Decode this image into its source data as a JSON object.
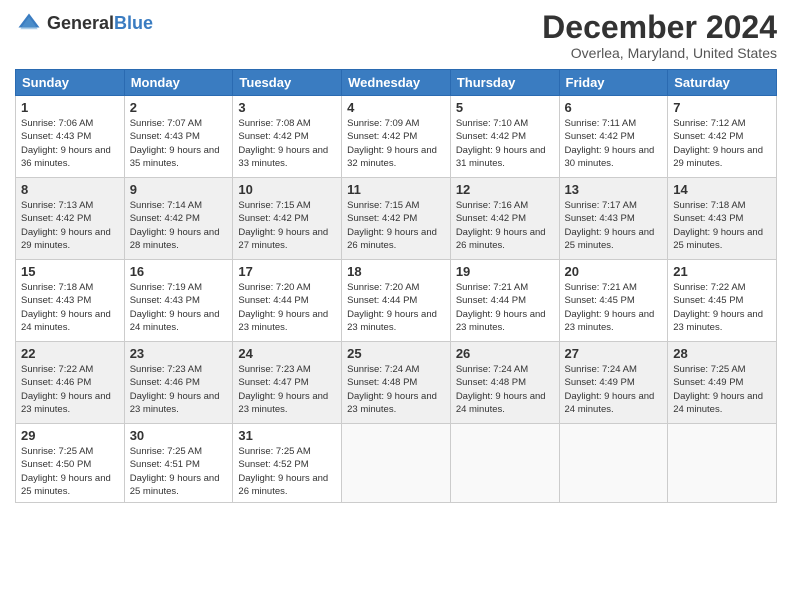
{
  "header": {
    "logo_general": "General",
    "logo_blue": "Blue",
    "title": "December 2024",
    "location": "Overlea, Maryland, United States"
  },
  "columns": [
    "Sunday",
    "Monday",
    "Tuesday",
    "Wednesday",
    "Thursday",
    "Friday",
    "Saturday"
  ],
  "weeks": [
    [
      {
        "day": "1",
        "sunrise": "Sunrise: 7:06 AM",
        "sunset": "Sunset: 4:43 PM",
        "daylight": "Daylight: 9 hours and 36 minutes."
      },
      {
        "day": "2",
        "sunrise": "Sunrise: 7:07 AM",
        "sunset": "Sunset: 4:43 PM",
        "daylight": "Daylight: 9 hours and 35 minutes."
      },
      {
        "day": "3",
        "sunrise": "Sunrise: 7:08 AM",
        "sunset": "Sunset: 4:42 PM",
        "daylight": "Daylight: 9 hours and 33 minutes."
      },
      {
        "day": "4",
        "sunrise": "Sunrise: 7:09 AM",
        "sunset": "Sunset: 4:42 PM",
        "daylight": "Daylight: 9 hours and 32 minutes."
      },
      {
        "day": "5",
        "sunrise": "Sunrise: 7:10 AM",
        "sunset": "Sunset: 4:42 PM",
        "daylight": "Daylight: 9 hours and 31 minutes."
      },
      {
        "day": "6",
        "sunrise": "Sunrise: 7:11 AM",
        "sunset": "Sunset: 4:42 PM",
        "daylight": "Daylight: 9 hours and 30 minutes."
      },
      {
        "day": "7",
        "sunrise": "Sunrise: 7:12 AM",
        "sunset": "Sunset: 4:42 PM",
        "daylight": "Daylight: 9 hours and 29 minutes."
      }
    ],
    [
      {
        "day": "8",
        "sunrise": "Sunrise: 7:13 AM",
        "sunset": "Sunset: 4:42 PM",
        "daylight": "Daylight: 9 hours and 29 minutes."
      },
      {
        "day": "9",
        "sunrise": "Sunrise: 7:14 AM",
        "sunset": "Sunset: 4:42 PM",
        "daylight": "Daylight: 9 hours and 28 minutes."
      },
      {
        "day": "10",
        "sunrise": "Sunrise: 7:15 AM",
        "sunset": "Sunset: 4:42 PM",
        "daylight": "Daylight: 9 hours and 27 minutes."
      },
      {
        "day": "11",
        "sunrise": "Sunrise: 7:15 AM",
        "sunset": "Sunset: 4:42 PM",
        "daylight": "Daylight: 9 hours and 26 minutes."
      },
      {
        "day": "12",
        "sunrise": "Sunrise: 7:16 AM",
        "sunset": "Sunset: 4:42 PM",
        "daylight": "Daylight: 9 hours and 26 minutes."
      },
      {
        "day": "13",
        "sunrise": "Sunrise: 7:17 AM",
        "sunset": "Sunset: 4:43 PM",
        "daylight": "Daylight: 9 hours and 25 minutes."
      },
      {
        "day": "14",
        "sunrise": "Sunrise: 7:18 AM",
        "sunset": "Sunset: 4:43 PM",
        "daylight": "Daylight: 9 hours and 25 minutes."
      }
    ],
    [
      {
        "day": "15",
        "sunrise": "Sunrise: 7:18 AM",
        "sunset": "Sunset: 4:43 PM",
        "daylight": "Daylight: 9 hours and 24 minutes."
      },
      {
        "day": "16",
        "sunrise": "Sunrise: 7:19 AM",
        "sunset": "Sunset: 4:43 PM",
        "daylight": "Daylight: 9 hours and 24 minutes."
      },
      {
        "day": "17",
        "sunrise": "Sunrise: 7:20 AM",
        "sunset": "Sunset: 4:44 PM",
        "daylight": "Daylight: 9 hours and 23 minutes."
      },
      {
        "day": "18",
        "sunrise": "Sunrise: 7:20 AM",
        "sunset": "Sunset: 4:44 PM",
        "daylight": "Daylight: 9 hours and 23 minutes."
      },
      {
        "day": "19",
        "sunrise": "Sunrise: 7:21 AM",
        "sunset": "Sunset: 4:44 PM",
        "daylight": "Daylight: 9 hours and 23 minutes."
      },
      {
        "day": "20",
        "sunrise": "Sunrise: 7:21 AM",
        "sunset": "Sunset: 4:45 PM",
        "daylight": "Daylight: 9 hours and 23 minutes."
      },
      {
        "day": "21",
        "sunrise": "Sunrise: 7:22 AM",
        "sunset": "Sunset: 4:45 PM",
        "daylight": "Daylight: 9 hours and 23 minutes."
      }
    ],
    [
      {
        "day": "22",
        "sunrise": "Sunrise: 7:22 AM",
        "sunset": "Sunset: 4:46 PM",
        "daylight": "Daylight: 9 hours and 23 minutes."
      },
      {
        "day": "23",
        "sunrise": "Sunrise: 7:23 AM",
        "sunset": "Sunset: 4:46 PM",
        "daylight": "Daylight: 9 hours and 23 minutes."
      },
      {
        "day": "24",
        "sunrise": "Sunrise: 7:23 AM",
        "sunset": "Sunset: 4:47 PM",
        "daylight": "Daylight: 9 hours and 23 minutes."
      },
      {
        "day": "25",
        "sunrise": "Sunrise: 7:24 AM",
        "sunset": "Sunset: 4:48 PM",
        "daylight": "Daylight: 9 hours and 23 minutes."
      },
      {
        "day": "26",
        "sunrise": "Sunrise: 7:24 AM",
        "sunset": "Sunset: 4:48 PM",
        "daylight": "Daylight: 9 hours and 24 minutes."
      },
      {
        "day": "27",
        "sunrise": "Sunrise: 7:24 AM",
        "sunset": "Sunset: 4:49 PM",
        "daylight": "Daylight: 9 hours and 24 minutes."
      },
      {
        "day": "28",
        "sunrise": "Sunrise: 7:25 AM",
        "sunset": "Sunset: 4:49 PM",
        "daylight": "Daylight: 9 hours and 24 minutes."
      }
    ],
    [
      {
        "day": "29",
        "sunrise": "Sunrise: 7:25 AM",
        "sunset": "Sunset: 4:50 PM",
        "daylight": "Daylight: 9 hours and 25 minutes."
      },
      {
        "day": "30",
        "sunrise": "Sunrise: 7:25 AM",
        "sunset": "Sunset: 4:51 PM",
        "daylight": "Daylight: 9 hours and 25 minutes."
      },
      {
        "day": "31",
        "sunrise": "Sunrise: 7:25 AM",
        "sunset": "Sunset: 4:52 PM",
        "daylight": "Daylight: 9 hours and 26 minutes."
      },
      {
        "day": "",
        "sunrise": "",
        "sunset": "",
        "daylight": ""
      },
      {
        "day": "",
        "sunrise": "",
        "sunset": "",
        "daylight": ""
      },
      {
        "day": "",
        "sunrise": "",
        "sunset": "",
        "daylight": ""
      },
      {
        "day": "",
        "sunrise": "",
        "sunset": "",
        "daylight": ""
      }
    ]
  ]
}
